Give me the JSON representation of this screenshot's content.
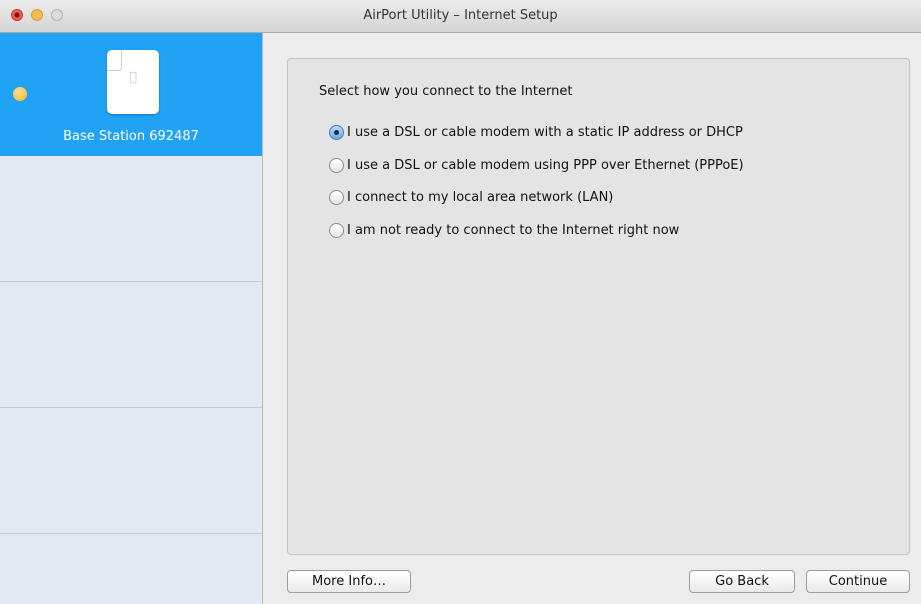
{
  "window": {
    "title": "AirPort Utility – Internet Setup"
  },
  "sidebar": {
    "station": {
      "label": "Base Station 692487",
      "status": "yellow",
      "icon": "airport-base-station-icon"
    }
  },
  "main": {
    "prompt": "Select how you connect to the Internet",
    "options": [
      {
        "label": "I use a DSL or cable modem with a static IP address or DHCP",
        "selected": true
      },
      {
        "label": "I use a DSL or cable modem using PPP over Ethernet (PPPoE)",
        "selected": false
      },
      {
        "label": "I connect to my local area network (LAN)",
        "selected": false
      },
      {
        "label": "I am not ready to connect to the Internet right now",
        "selected": false
      }
    ]
  },
  "buttons": {
    "more_info": "More Info…",
    "go_back": "Go Back",
    "continue": "Continue"
  },
  "colors": {
    "selection": "#21a3f5",
    "sidebar_bg": "#e3e9f3",
    "panel_bg": "#e4e4e4"
  }
}
